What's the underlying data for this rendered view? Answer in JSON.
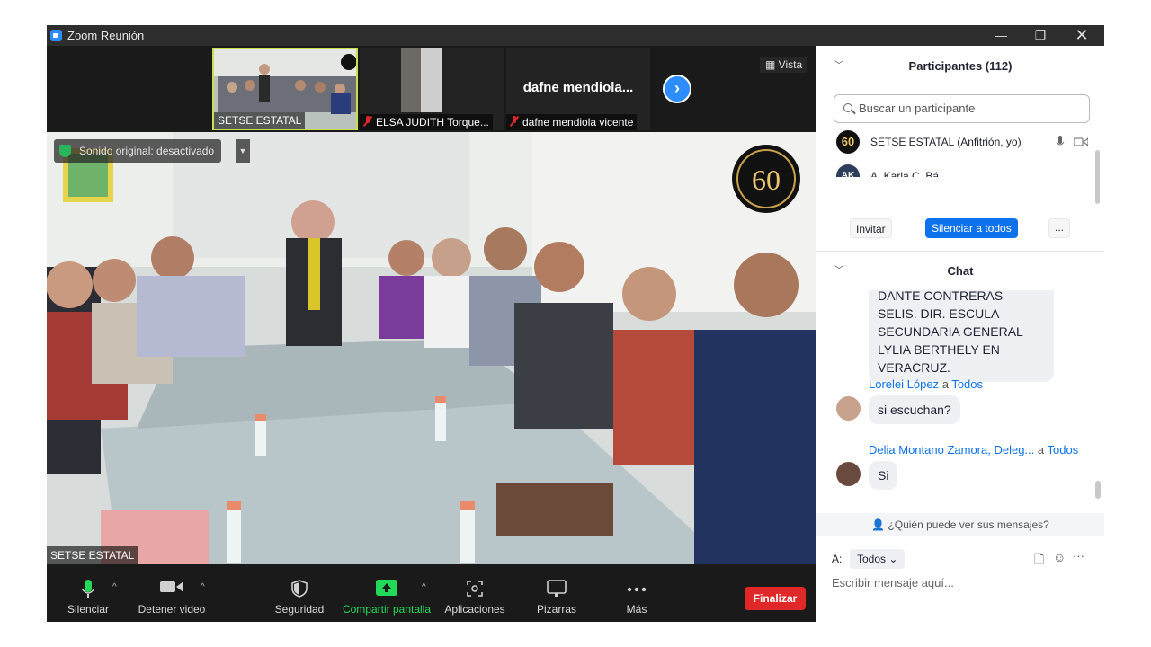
{
  "window": {
    "title": "Zoom Reunión"
  },
  "thumbnails": [
    {
      "name": "SETSE ESTATAL",
      "muted": false
    },
    {
      "name": "ELSA JUDITH Torque...",
      "muted": true
    },
    {
      "name": "dafne mendiola vicente",
      "muted": true,
      "display_name": "dafne  mendiola..."
    }
  ],
  "view_label": "Vista",
  "main_video": {
    "speaker_name": "SETSE ESTATAL",
    "original_sound": "Sonido original: desactivado"
  },
  "toolbar": {
    "mute": "Silenciar",
    "video": "Detener video",
    "security": "Seguridad",
    "share": "Compartir pantalla",
    "apps": "Aplicaciones",
    "whiteboards": "Pizarras",
    "more": "Más",
    "end": "Finalizar"
  },
  "participants": {
    "title": "Participantes (112)",
    "search_placeholder": "Buscar un participante",
    "list": [
      {
        "name": "SETSE ESTATAL (Anfitrión, yo)",
        "avatar": "60"
      },
      {
        "name": "A. Karla C. Bá...",
        "avatar": "AK"
      }
    ],
    "invite": "Invitar",
    "mute_all": "Silenciar a todos",
    "more": "..."
  },
  "chat": {
    "title": "Chat",
    "messages": [
      {
        "sender": "",
        "to": "",
        "text": "DANTE  CONTRERAS SELIS. DIR. ESCULA SECUNDARIA GENERAL LYLIA BERTHELY EN VERACRUZ."
      },
      {
        "sender": "Lorelei López",
        "to": "Todos",
        "text": "si escuchan?"
      },
      {
        "sender": "Delia Montano Zamora, Deleg...",
        "to": "Todos",
        "text": "Si"
      }
    ],
    "to_word": "a",
    "who_can_see": "¿Quién puede ver sus mensajes?",
    "to_label": "A:",
    "to_value": "Todos",
    "input_placeholder": "Escribir mensaje aquí..."
  },
  "colors": {
    "accent": "#0e72ed",
    "end": "#e02828",
    "share": "#23d959"
  }
}
